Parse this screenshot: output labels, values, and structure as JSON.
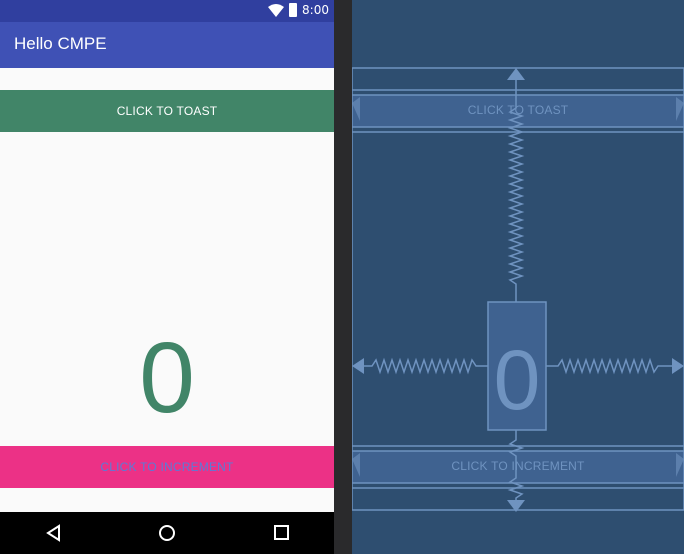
{
  "status_bar": {
    "time": "8:00",
    "wifi_icon": "wifi-icon",
    "battery_icon": "battery-icon"
  },
  "app_bar": {
    "title": "Hello CMPE"
  },
  "buttons": {
    "toast_label": "CLICK TO TOAST",
    "increment_label": "CLICK TO INCREMENT"
  },
  "counter": {
    "value": "0"
  },
  "nav_bar": {
    "back_icon": "back-icon",
    "home_icon": "home-icon",
    "recents_icon": "recents-icon"
  },
  "blueprint": {
    "toast_label": "CLICK TO TOAST",
    "increment_label": "CLICK TO INCREMENT",
    "counter_value": "0"
  },
  "colors": {
    "status_bar": "#303f9f",
    "app_bar": "#3f51b5",
    "toast_button": "#418568",
    "increment_button": "#ec3186",
    "increment_text": "#5b7bd6",
    "counter_text": "#418568",
    "blueprint_bg": "#2e4e70",
    "blueprint_line": "#6f93c0"
  }
}
